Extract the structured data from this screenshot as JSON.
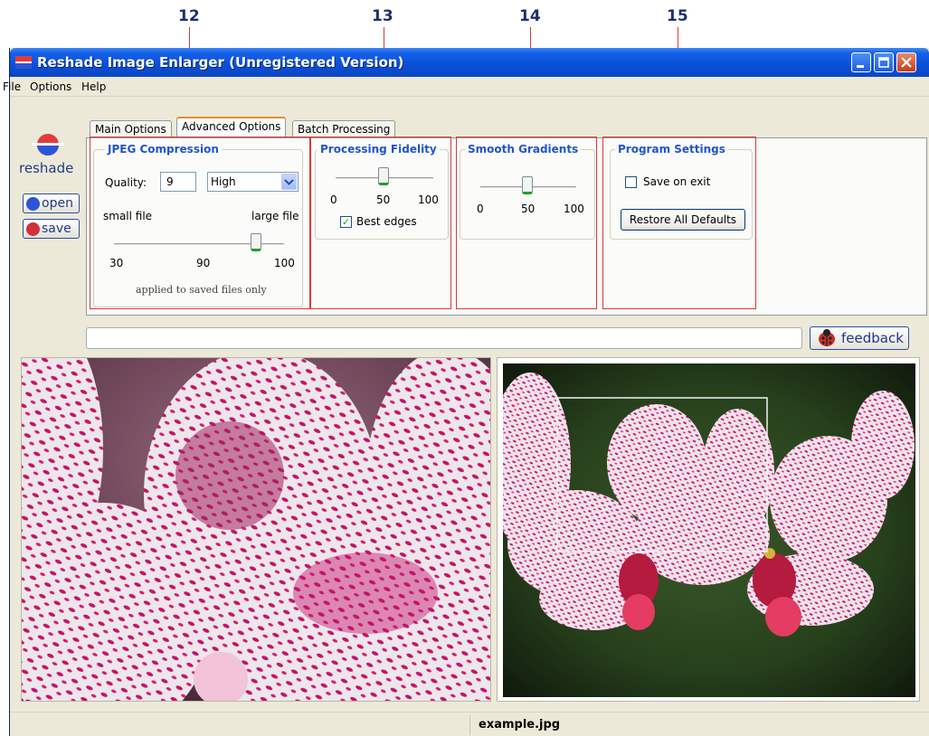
{
  "callouts": [
    "12",
    "13",
    "14",
    "15"
  ],
  "window": {
    "title": "Reshade Image Enlarger (Unregistered Version)"
  },
  "menu": [
    "File",
    "Options",
    "Help"
  ],
  "sidebar": {
    "logo_text": "reshade",
    "open_label": "open",
    "save_label": "save"
  },
  "tabs": [
    "Main Options",
    "Advanced Options",
    "Batch Processing"
  ],
  "active_tab": "Advanced Options",
  "jpeg": {
    "title": "JPEG Compression",
    "quality_label": "Quality:",
    "quality_value": "9",
    "preset": "High",
    "small_label": "small file",
    "large_label": "large file",
    "slider_value": 90,
    "ticks": [
      "30",
      "90",
      "100"
    ],
    "note": "applied to saved files only"
  },
  "fidelity": {
    "title": "Processing Fidelity",
    "ticks": [
      "0",
      "50",
      "100"
    ],
    "value": 50,
    "best_edges_label": "Best edges",
    "best_edges_checked": true
  },
  "gradients": {
    "title": "Smooth Gradients",
    "ticks": [
      "0",
      "50",
      "100"
    ],
    "value": 50
  },
  "program": {
    "title": "Program Settings",
    "save_on_exit_label": "Save on exit",
    "save_on_exit_checked": false,
    "restore_label": "Restore All Defaults"
  },
  "feedback_label": "feedback",
  "status": {
    "filename": "example.jpg"
  },
  "colors": {
    "group_title": "#2155c8",
    "callout": "#1f2f6e",
    "highlight_box": "#d93a3a",
    "slider_accent": "#21a121"
  }
}
